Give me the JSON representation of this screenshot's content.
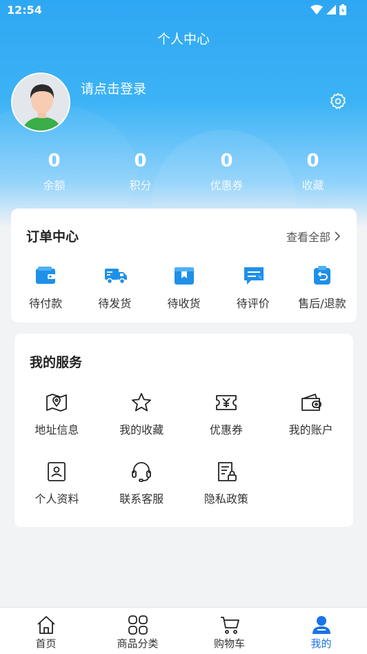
{
  "status_bar": {
    "time": "12:54"
  },
  "header": {
    "title": "个人中心"
  },
  "profile": {
    "login_text": "请点击登录"
  },
  "stats": [
    {
      "value": "0",
      "label": "余额"
    },
    {
      "value": "0",
      "label": "积分"
    },
    {
      "value": "0",
      "label": "优惠券"
    },
    {
      "value": "0",
      "label": "收藏"
    }
  ],
  "orders": {
    "title": "订单中心",
    "view_all": "查看全部",
    "items": [
      {
        "label": "待付款",
        "icon": "wallet-icon"
      },
      {
        "label": "待发货",
        "icon": "truck-icon"
      },
      {
        "label": "待收货",
        "icon": "package-icon"
      },
      {
        "label": "待评价",
        "icon": "comment-icon"
      },
      {
        "label": "售后/退款",
        "icon": "refund-icon"
      }
    ]
  },
  "services": {
    "title": "我的服务",
    "items": [
      {
        "label": "地址信息",
        "icon": "map-icon"
      },
      {
        "label": "我的收藏",
        "icon": "star-icon"
      },
      {
        "label": "优惠券",
        "icon": "coupon-icon"
      },
      {
        "label": "我的账户",
        "icon": "wallet-outline-icon"
      },
      {
        "label": "个人资料",
        "icon": "profile-card-icon"
      },
      {
        "label": "联系客服",
        "icon": "headset-icon"
      },
      {
        "label": "隐私政策",
        "icon": "document-lock-icon"
      }
    ]
  },
  "tabbar": [
    {
      "label": "首页",
      "icon": "home-icon"
    },
    {
      "label": "商品分类",
      "icon": "category-icon"
    },
    {
      "label": "购物车",
      "icon": "cart-icon"
    },
    {
      "label": "我的",
      "icon": "user-icon",
      "active": true
    }
  ],
  "colors": {
    "accent": "#1a73e8",
    "header_blue": "#2ea7f3",
    "icon_blue": "#1e90e8"
  }
}
